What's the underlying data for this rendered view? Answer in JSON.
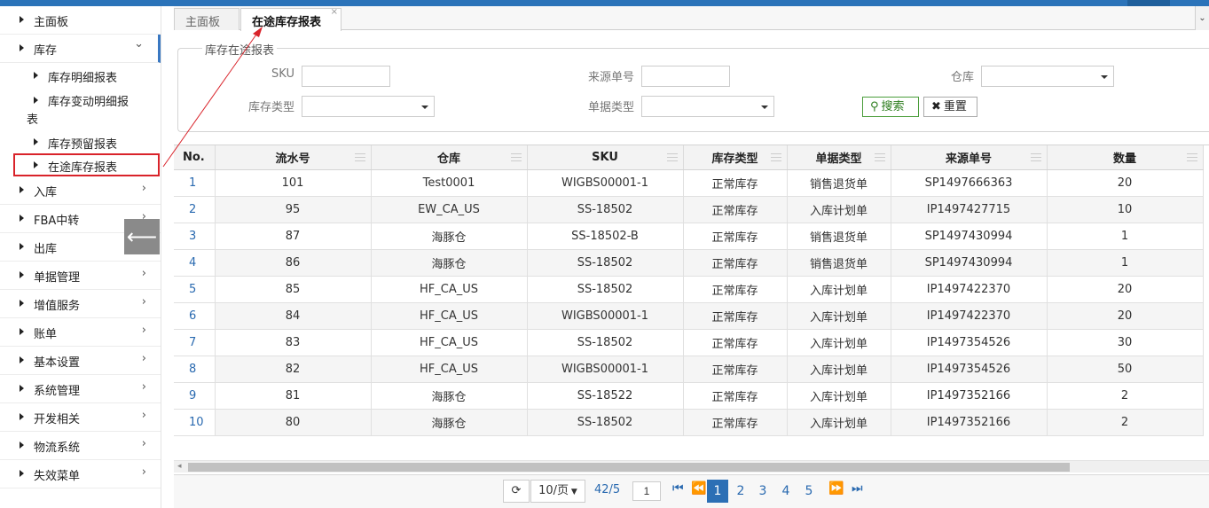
{
  "sidebar": {
    "items": [
      {
        "label": "主面板"
      },
      {
        "label": "库存",
        "open": true
      },
      {
        "label": "入库"
      },
      {
        "label": "FBA中转"
      },
      {
        "label": "出库"
      },
      {
        "label": "单据管理"
      },
      {
        "label": "增值服务"
      },
      {
        "label": "账单"
      },
      {
        "label": "基本设置"
      },
      {
        "label": "系统管理"
      },
      {
        "label": "开发相关"
      },
      {
        "label": "物流系统"
      },
      {
        "label": "失效菜单"
      }
    ],
    "subitems": [
      {
        "label": "库存明细报表"
      },
      {
        "label": "库存变动明细报",
        "label_wrap": "表"
      },
      {
        "label": "库存预留报表"
      },
      {
        "label": "在途库存报表",
        "active": true
      }
    ],
    "open_chevron": "⌄",
    "closed_chevron": "›",
    "collapse_icon": "arrow-left-icon"
  },
  "tabs": [
    {
      "label": "主面板"
    },
    {
      "label": "在途库存报表",
      "active": true,
      "close": "×"
    }
  ],
  "filter": {
    "legend": "库存在途报表",
    "sku_label": "SKU",
    "source_no_label": "来源单号",
    "warehouse_label": "仓库",
    "stock_type_label": "库存类型",
    "doc_type_label": "单据类型",
    "search_label": "搜索",
    "reset_label": "重置"
  },
  "table": {
    "headers": [
      "No.",
      "流水号",
      "仓库",
      "SKU",
      "库存类型",
      "单据类型",
      "来源单号",
      "数量"
    ],
    "rows": [
      [
        "1",
        "101",
        "Test0001",
        "WIGBS00001-1",
        "正常库存",
        "销售退货单",
        "SP1497666363",
        "20"
      ],
      [
        "2",
        "95",
        "EW_CA_US",
        "SS-18502",
        "正常库存",
        "入库计划单",
        "IP1497427715",
        "10"
      ],
      [
        "3",
        "87",
        "海豚仓",
        "SS-18502-B",
        "正常库存",
        "销售退货单",
        "SP1497430994",
        "1"
      ],
      [
        "4",
        "86",
        "海豚仓",
        "SS-18502",
        "正常库存",
        "销售退货单",
        "SP1497430994",
        "1"
      ],
      [
        "5",
        "85",
        "HF_CA_US",
        "SS-18502",
        "正常库存",
        "入库计划单",
        "IP1497422370",
        "20"
      ],
      [
        "6",
        "84",
        "HF_CA_US",
        "WIGBS00001-1",
        "正常库存",
        "入库计划单",
        "IP1497422370",
        "20"
      ],
      [
        "7",
        "83",
        "HF_CA_US",
        "SS-18502",
        "正常库存",
        "入库计划单",
        "IP1497354526",
        "30"
      ],
      [
        "8",
        "82",
        "HF_CA_US",
        "WIGBS00001-1",
        "正常库存",
        "入库计划单",
        "IP1497354526",
        "50"
      ],
      [
        "9",
        "81",
        "海豚仓",
        "SS-18522",
        "正常库存",
        "入库计划单",
        "IP1497352166",
        "2"
      ],
      [
        "10",
        "80",
        "海豚仓",
        "SS-18502",
        "正常库存",
        "入库计划单",
        "IP1497352166",
        "2"
      ]
    ]
  },
  "pager": {
    "page_size": "10/页",
    "page_info": "42/5",
    "current_input": "1",
    "pages": [
      "1",
      "2",
      "3",
      "4",
      "5"
    ],
    "current_page": "1"
  },
  "colors": {
    "accent": "#2c6fb5",
    "highlight_border": "#d9232a",
    "search_green": "#2d7d1e"
  }
}
